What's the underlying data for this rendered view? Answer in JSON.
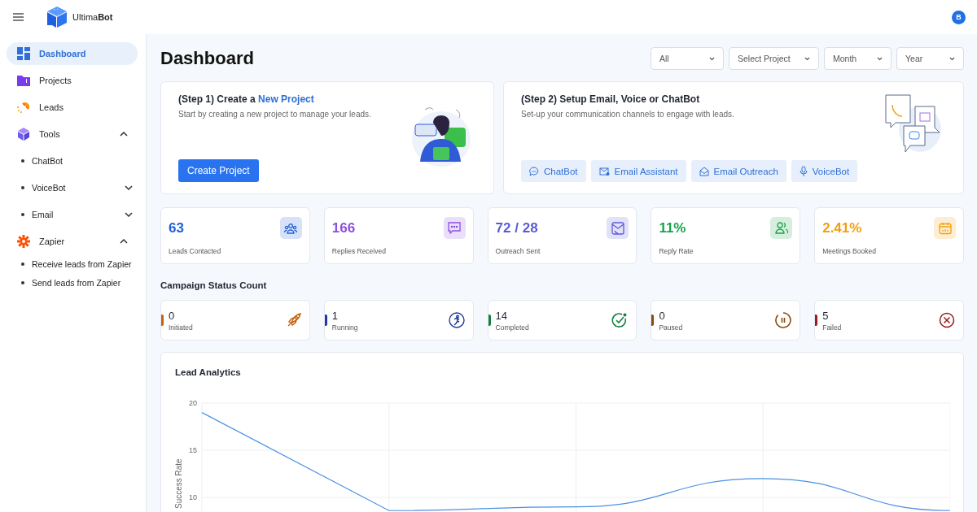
{
  "brand": {
    "name": "Ultima**Bot**"
  },
  "user": {
    "initial": "B"
  },
  "sidebar": {
    "items": [
      {
        "label": "Dashboard",
        "selected": true
      },
      {
        "label": "Projects",
        "selected": false
      },
      {
        "label": "Leads",
        "selected": false
      },
      {
        "label": "Tools",
        "selected": false,
        "expanded": true,
        "children": [
          {
            "label": "ChatBot",
            "selected": false
          },
          {
            "label": "VoiceBot",
            "selected": false,
            "expanded": false
          },
          {
            "label": "Email",
            "selected": false,
            "expanded": false
          }
        ]
      },
      {
        "label": "Zapier",
        "selected": false,
        "expanded": true,
        "children": [
          {
            "label": "Receive leads from Zapier",
            "selected": false
          },
          {
            "label": "Send leads from Zapier",
            "selected": false
          }
        ]
      }
    ]
  },
  "page_title": "Dashboard",
  "filters": [
    "All",
    "Select Project",
    "Month",
    "Year"
  ],
  "step1": {
    "title": "(Step 1) Create a **New Project**",
    "description": "Start by creating a new project to manage your leads.",
    "button": "Create Project"
  },
  "step2": {
    "title": "(Step 2) Setup Email, Voice or ChatBot",
    "description": "Set-up your communication channels to engage with leads.",
    "buttons": [
      "ChatBot",
      "Email Assistant",
      "Email Outreach",
      "VoiceBot"
    ]
  },
  "stats": [
    {
      "value": "63",
      "label": "Leads Contacted",
      "color": "#1f5fd6"
    },
    {
      "value": "166",
      "label": "Replies Received",
      "color": "#8b4fe0"
    },
    {
      "value": "72 / 28",
      "label": "Outreach Sent",
      "color": "#5b5bd6"
    },
    {
      "value": "11%",
      "label": "Reply Rate",
      "color": "#16a34a"
    },
    {
      "value": "2.41%",
      "label": "Meetings Booked",
      "color": "#f59e0b"
    }
  ],
  "campaign_title": "Campaign Status Count",
  "statuses": [
    {
      "count": "0",
      "label": "Initiated",
      "color": "#c2620e"
    },
    {
      "count": "1",
      "label": "Running",
      "color": "#1e3a9a"
    },
    {
      "count": "14",
      "label": "Completed",
      "color": "#15803d"
    },
    {
      "count": "0",
      "label": "Paused",
      "color": "#8a4a10"
    },
    {
      "count": "5",
      "label": "Failed",
      "color": "#991b1b"
    }
  ],
  "analytics": {
    "title": "Lead Analytics",
    "chart_data": {
      "type": "line",
      "ylabel": "Success Rate",
      "yticks": [
        10,
        15,
        20
      ],
      "ylim": [
        8.5,
        20
      ],
      "grid": true,
      "series": [
        {
          "color": "#4a90e2",
          "values": [
            19,
            8.6,
            9,
            12,
            8.6
          ]
        }
      ]
    }
  }
}
